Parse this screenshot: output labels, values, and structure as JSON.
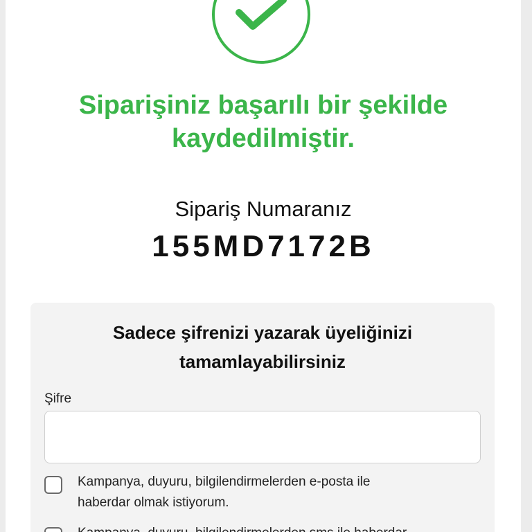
{
  "success": {
    "icon": "check-circle-icon",
    "title_line1": "Siparişiniz başarılı bir şekilde",
    "title_line2": "kaydedilmiştir."
  },
  "order": {
    "label": "Sipariş Numaranız",
    "number": "155MD7172B"
  },
  "membership": {
    "title_line1": "Sadece şifrenizi yazarak üyeliğinizi",
    "title_line2": "tamamlayabilirsiniz",
    "password_label": "Şifre",
    "password_value": "",
    "consents": [
      {
        "checked": false,
        "line1": "Kampanya, duyuru, bilgilendirmelerden e-posta ile",
        "line2": "haberdar olmak istiyorum."
      },
      {
        "checked": false,
        "line1": "Kampanya, duyuru, bilgilendirmelerden sms ile haberdar"
      }
    ]
  },
  "colors": {
    "success": "#3bb54a",
    "panel_background": "#f3f3f3"
  }
}
